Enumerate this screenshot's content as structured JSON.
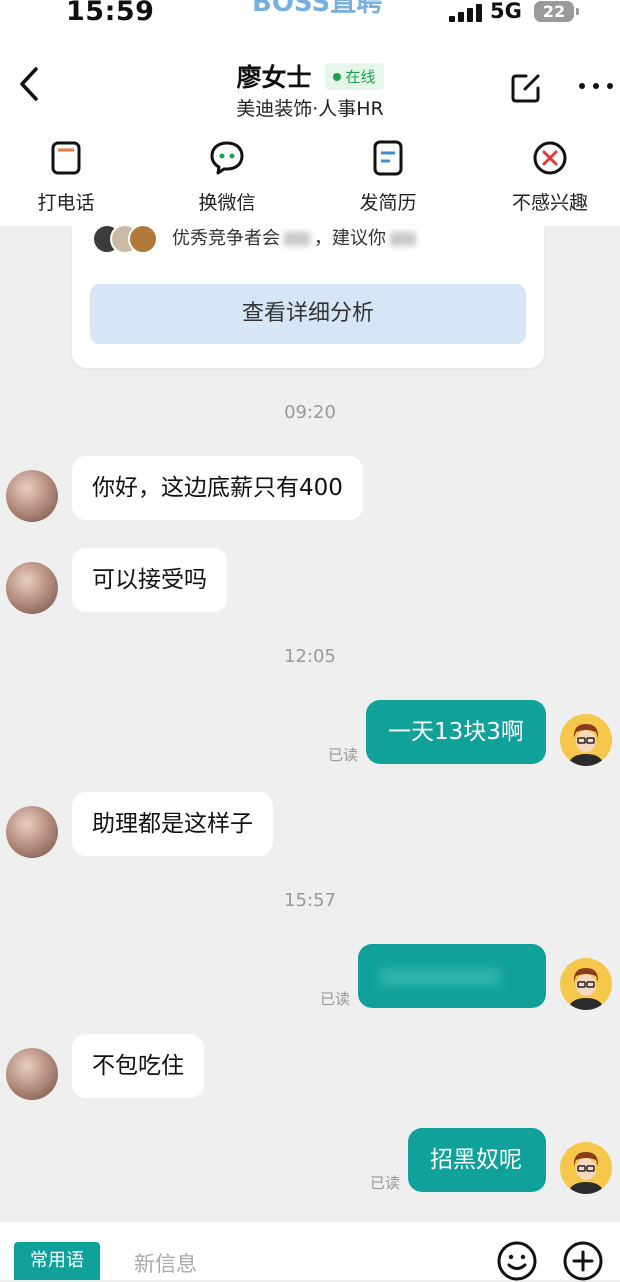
{
  "status_bar": {
    "time": "15:59",
    "app_name": "BOSS直聘",
    "network": "5G",
    "battery": "22"
  },
  "header": {
    "contact_name": "廖女士",
    "online_status": "在线",
    "company": "美迪装饰·人事HR",
    "actions": [
      {
        "label": "打电话",
        "icon": "phone-icon"
      },
      {
        "label": "换微信",
        "icon": "wechat-icon"
      },
      {
        "label": "发简历",
        "icon": "resume-icon"
      },
      {
        "label": "不感兴趣",
        "icon": "not-interested-icon"
      }
    ]
  },
  "analysis_card": {
    "text_prefix": "优秀竞争者会",
    "text_middle": "，建议你",
    "button_label": "查看详细分析"
  },
  "messages": [
    {
      "type": "timestamp",
      "text": "09:20"
    },
    {
      "type": "received",
      "text": "你好，这边底薪只有400"
    },
    {
      "type": "received",
      "text": "可以接受吗"
    },
    {
      "type": "timestamp",
      "text": "12:05"
    },
    {
      "type": "sent",
      "text": "一天13块3啊",
      "status": "已读"
    },
    {
      "type": "received",
      "text": "助理都是这样子"
    },
    {
      "type": "timestamp",
      "text": "15:57"
    },
    {
      "type": "sent",
      "text": "",
      "status": "已读"
    },
    {
      "type": "received",
      "text": "不包吃住"
    },
    {
      "type": "sent",
      "text": "招黑奴呢",
      "status": "已读"
    }
  ],
  "input_bar": {
    "phrases_label": "常用语",
    "placeholder": "新信息"
  },
  "colors": {
    "accent": "#10a19b",
    "online": "#20a04a",
    "background": "#efefef"
  }
}
